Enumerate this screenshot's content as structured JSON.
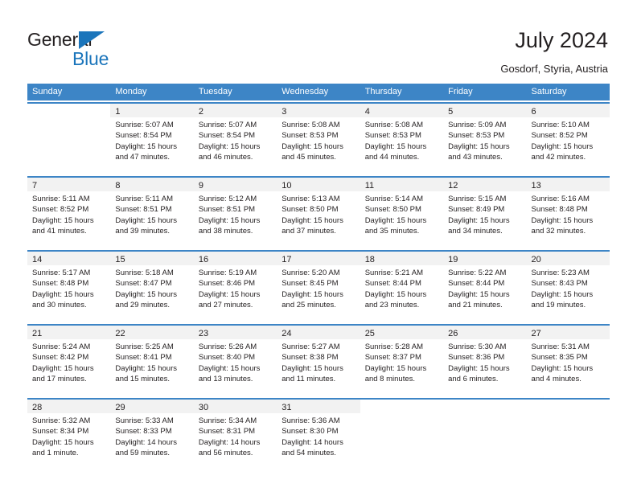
{
  "brand": {
    "name_top": "General",
    "name_bottom": "Blue",
    "triangle_color": "#1b75bb",
    "text_color": "#231f20"
  },
  "header": {
    "title": "July 2024",
    "subtitle": "Gosdorf, Styria, Austria"
  },
  "theme": {
    "header_blue": "#3d85c6",
    "daynum_band": "#f2f2f2",
    "text": "#231f20",
    "page_background": "#ffffff"
  },
  "weekdays": [
    "Sunday",
    "Monday",
    "Tuesday",
    "Wednesday",
    "Thursday",
    "Friday",
    "Saturday"
  ],
  "weeks": [
    [
      {
        "day": "",
        "lines": []
      },
      {
        "day": "1",
        "lines": [
          "Sunrise: 5:07 AM",
          "Sunset: 8:54 PM",
          "Daylight: 15 hours",
          "and 47 minutes."
        ]
      },
      {
        "day": "2",
        "lines": [
          "Sunrise: 5:07 AM",
          "Sunset: 8:54 PM",
          "Daylight: 15 hours",
          "and 46 minutes."
        ]
      },
      {
        "day": "3",
        "lines": [
          "Sunrise: 5:08 AM",
          "Sunset: 8:53 PM",
          "Daylight: 15 hours",
          "and 45 minutes."
        ]
      },
      {
        "day": "4",
        "lines": [
          "Sunrise: 5:08 AM",
          "Sunset: 8:53 PM",
          "Daylight: 15 hours",
          "and 44 minutes."
        ]
      },
      {
        "day": "5",
        "lines": [
          "Sunrise: 5:09 AM",
          "Sunset: 8:53 PM",
          "Daylight: 15 hours",
          "and 43 minutes."
        ]
      },
      {
        "day": "6",
        "lines": [
          "Sunrise: 5:10 AM",
          "Sunset: 8:52 PM",
          "Daylight: 15 hours",
          "and 42 minutes."
        ]
      }
    ],
    [
      {
        "day": "7",
        "lines": [
          "Sunrise: 5:11 AM",
          "Sunset: 8:52 PM",
          "Daylight: 15 hours",
          "and 41 minutes."
        ]
      },
      {
        "day": "8",
        "lines": [
          "Sunrise: 5:11 AM",
          "Sunset: 8:51 PM",
          "Daylight: 15 hours",
          "and 39 minutes."
        ]
      },
      {
        "day": "9",
        "lines": [
          "Sunrise: 5:12 AM",
          "Sunset: 8:51 PM",
          "Daylight: 15 hours",
          "and 38 minutes."
        ]
      },
      {
        "day": "10",
        "lines": [
          "Sunrise: 5:13 AM",
          "Sunset: 8:50 PM",
          "Daylight: 15 hours",
          "and 37 minutes."
        ]
      },
      {
        "day": "11",
        "lines": [
          "Sunrise: 5:14 AM",
          "Sunset: 8:50 PM",
          "Daylight: 15 hours",
          "and 35 minutes."
        ]
      },
      {
        "day": "12",
        "lines": [
          "Sunrise: 5:15 AM",
          "Sunset: 8:49 PM",
          "Daylight: 15 hours",
          "and 34 minutes."
        ]
      },
      {
        "day": "13",
        "lines": [
          "Sunrise: 5:16 AM",
          "Sunset: 8:48 PM",
          "Daylight: 15 hours",
          "and 32 minutes."
        ]
      }
    ],
    [
      {
        "day": "14",
        "lines": [
          "Sunrise: 5:17 AM",
          "Sunset: 8:48 PM",
          "Daylight: 15 hours",
          "and 30 minutes."
        ]
      },
      {
        "day": "15",
        "lines": [
          "Sunrise: 5:18 AM",
          "Sunset: 8:47 PM",
          "Daylight: 15 hours",
          "and 29 minutes."
        ]
      },
      {
        "day": "16",
        "lines": [
          "Sunrise: 5:19 AM",
          "Sunset: 8:46 PM",
          "Daylight: 15 hours",
          "and 27 minutes."
        ]
      },
      {
        "day": "17",
        "lines": [
          "Sunrise: 5:20 AM",
          "Sunset: 8:45 PM",
          "Daylight: 15 hours",
          "and 25 minutes."
        ]
      },
      {
        "day": "18",
        "lines": [
          "Sunrise: 5:21 AM",
          "Sunset: 8:44 PM",
          "Daylight: 15 hours",
          "and 23 minutes."
        ]
      },
      {
        "day": "19",
        "lines": [
          "Sunrise: 5:22 AM",
          "Sunset: 8:44 PM",
          "Daylight: 15 hours",
          "and 21 minutes."
        ]
      },
      {
        "day": "20",
        "lines": [
          "Sunrise: 5:23 AM",
          "Sunset: 8:43 PM",
          "Daylight: 15 hours",
          "and 19 minutes."
        ]
      }
    ],
    [
      {
        "day": "21",
        "lines": [
          "Sunrise: 5:24 AM",
          "Sunset: 8:42 PM",
          "Daylight: 15 hours",
          "and 17 minutes."
        ]
      },
      {
        "day": "22",
        "lines": [
          "Sunrise: 5:25 AM",
          "Sunset: 8:41 PM",
          "Daylight: 15 hours",
          "and 15 minutes."
        ]
      },
      {
        "day": "23",
        "lines": [
          "Sunrise: 5:26 AM",
          "Sunset: 8:40 PM",
          "Daylight: 15 hours",
          "and 13 minutes."
        ]
      },
      {
        "day": "24",
        "lines": [
          "Sunrise: 5:27 AM",
          "Sunset: 8:38 PM",
          "Daylight: 15 hours",
          "and 11 minutes."
        ]
      },
      {
        "day": "25",
        "lines": [
          "Sunrise: 5:28 AM",
          "Sunset: 8:37 PM",
          "Daylight: 15 hours",
          "and 8 minutes."
        ]
      },
      {
        "day": "26",
        "lines": [
          "Sunrise: 5:30 AM",
          "Sunset: 8:36 PM",
          "Daylight: 15 hours",
          "and 6 minutes."
        ]
      },
      {
        "day": "27",
        "lines": [
          "Sunrise: 5:31 AM",
          "Sunset: 8:35 PM",
          "Daylight: 15 hours",
          "and 4 minutes."
        ]
      }
    ],
    [
      {
        "day": "28",
        "lines": [
          "Sunrise: 5:32 AM",
          "Sunset: 8:34 PM",
          "Daylight: 15 hours",
          "and 1 minute."
        ]
      },
      {
        "day": "29",
        "lines": [
          "Sunrise: 5:33 AM",
          "Sunset: 8:33 PM",
          "Daylight: 14 hours",
          "and 59 minutes."
        ]
      },
      {
        "day": "30",
        "lines": [
          "Sunrise: 5:34 AM",
          "Sunset: 8:31 PM",
          "Daylight: 14 hours",
          "and 56 minutes."
        ]
      },
      {
        "day": "31",
        "lines": [
          "Sunrise: 5:36 AM",
          "Sunset: 8:30 PM",
          "Daylight: 14 hours",
          "and 54 minutes."
        ]
      },
      {
        "day": "",
        "lines": []
      },
      {
        "day": "",
        "lines": []
      },
      {
        "day": "",
        "lines": []
      }
    ]
  ]
}
